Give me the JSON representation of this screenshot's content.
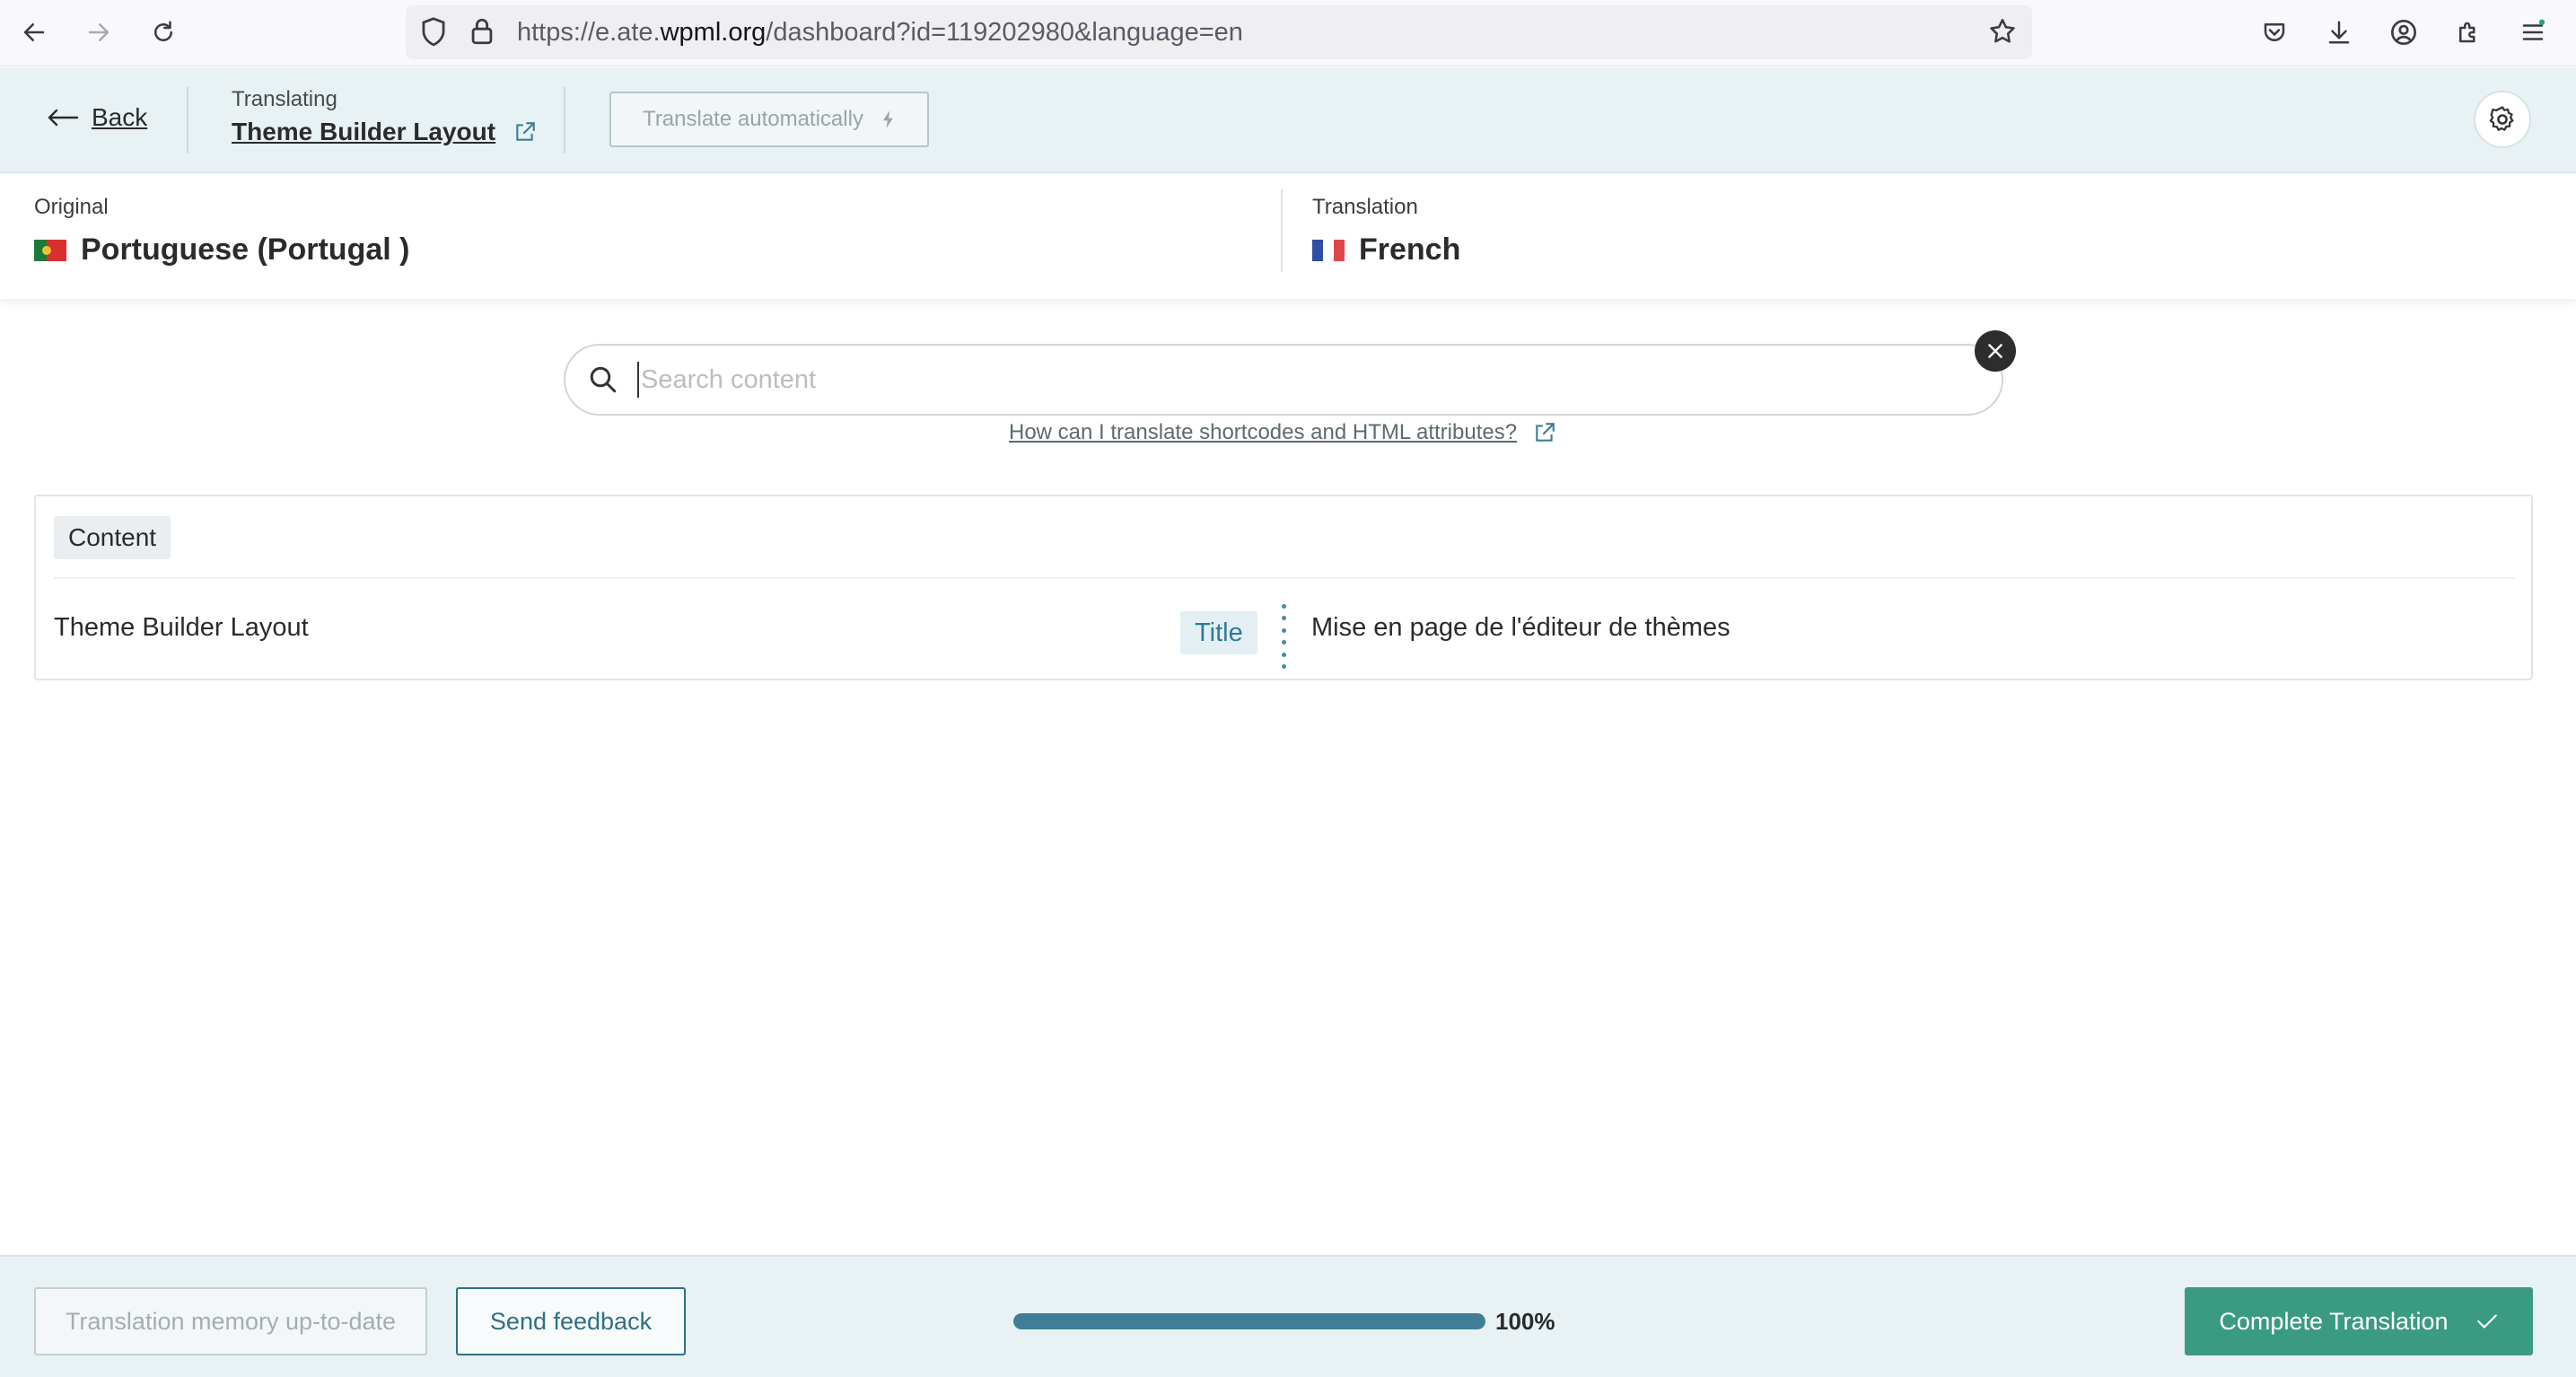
{
  "browser": {
    "url_prefix": "https://e.ate.",
    "url_domain": "wpml.org",
    "url_path": "/dashboard?id=119202980&language=en"
  },
  "header": {
    "back_label": "Back",
    "translating_label": "Translating",
    "doc_title": "Theme Builder Layout",
    "auto_translate_label": "Translate automatically"
  },
  "languages": {
    "original_label": "Original",
    "original_name": "Portuguese (Portugal )",
    "translation_label": "Translation",
    "translation_name": "French"
  },
  "search": {
    "placeholder": "Search content",
    "help_text": "How can I translate shortcodes and HTML attributes?"
  },
  "content": {
    "section_label": "Content",
    "rows": [
      {
        "original": "Theme Builder Layout",
        "field": "Title",
        "translation": "Mise en page de l'éditeur de thèmes"
      }
    ]
  },
  "footer": {
    "tm_label": "Translation memory up-to-date",
    "feedback_label": "Send feedback",
    "progress_percent": 100,
    "progress_text": "100%",
    "complete_label": "Complete Translation"
  },
  "colors": {
    "accent": "#3e7f97",
    "complete": "#3b9b82",
    "header_bg": "#e8f1f4"
  }
}
